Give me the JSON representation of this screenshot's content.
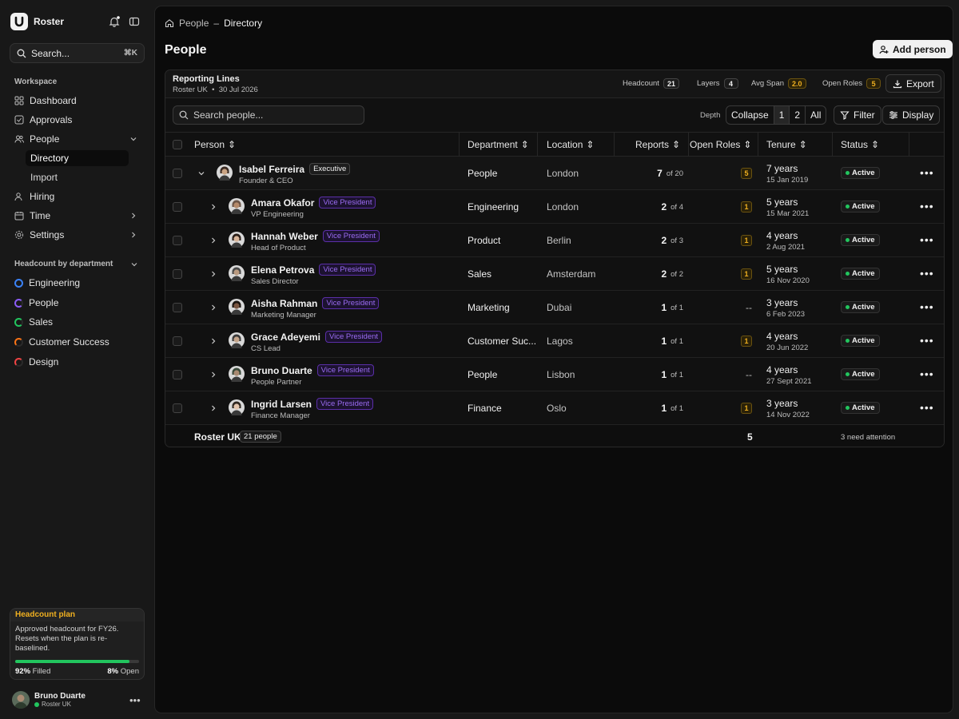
{
  "app": {
    "name": "Roster"
  },
  "search": {
    "placeholder": "Search...",
    "shortcut": "⌘K"
  },
  "sidebar": {
    "section_workspace": "Workspace",
    "items": [
      {
        "label": "Dashboard",
        "icon": "grid-icon"
      },
      {
        "label": "Approvals",
        "icon": "check-square-icon"
      },
      {
        "label": "People",
        "icon": "users-icon"
      },
      {
        "label": "Hiring",
        "icon": "user-plus-icon"
      },
      {
        "label": "Time",
        "icon": "calendar-icon"
      },
      {
        "label": "Settings",
        "icon": "gear-icon"
      }
    ],
    "people_sub": [
      {
        "label": "Directory"
      },
      {
        "label": "Import"
      }
    ],
    "section_headcount": "Headcount by department",
    "departments": [
      {
        "label": "Engineering",
        "color": "#3b82f6"
      },
      {
        "label": "People",
        "color": "#8b5cf6"
      },
      {
        "label": "Sales",
        "color": "#22c55e"
      },
      {
        "label": "Customer Success",
        "color": "#f97316"
      },
      {
        "label": "Design",
        "color": "#ef4444"
      }
    ]
  },
  "plan": {
    "title": "Headcount plan",
    "desc": "Approved headcount for FY26. Resets when the plan is re-baselined.",
    "filled_pct": "92%",
    "filled_label": "Filled",
    "open_pct": "8%",
    "open_label": "Open",
    "filled_value": 0.92
  },
  "user": {
    "name": "Bruno Duarte",
    "org": "Roster UK"
  },
  "breadcrumb": {
    "root": "People",
    "sep": "–",
    "current": "Directory"
  },
  "page": {
    "title": "People",
    "add_button": "Add person"
  },
  "panel": {
    "title": "Reporting Lines",
    "org": "Roster UK",
    "date": "30 Jul 2026",
    "stats": [
      {
        "label": "Headcount",
        "value": "21",
        "highlight": false
      },
      {
        "label": "Layers",
        "value": "4",
        "highlight": false
      },
      {
        "label": "Avg Span",
        "value": "2.0",
        "highlight": true
      },
      {
        "label": "Open Roles",
        "value": "5",
        "highlight": true
      }
    ],
    "export": "Export"
  },
  "toolbar": {
    "search_placeholder": "Search people...",
    "depth_label": "Depth",
    "depth_options": [
      "Collapse",
      "1",
      "2",
      "All"
    ],
    "filter": "Filter",
    "display": "Display"
  },
  "table": {
    "columns": [
      "Person",
      "Department",
      "Location",
      "Reports",
      "Open Roles",
      "Tenure",
      "Status"
    ],
    "rows": [
      {
        "name": "Isabel Ferreira",
        "role": "Founder & CEO",
        "tag": "Executive",
        "tagType": "exec",
        "dept": "People",
        "loc": "London",
        "rep": "7",
        "repOf": "of 20",
        "open": "5",
        "tenure": "7 years",
        "since": "15 Jan 2019",
        "status": "Active",
        "expanded": true,
        "skin": "#c9a383",
        "hair": "#3a2a22"
      },
      {
        "name": "Amara Okafor",
        "role": "VP Engineering",
        "tag": "Vice President",
        "tagType": "vp",
        "dept": "Engineering",
        "loc": "London",
        "rep": "2",
        "repOf": "of 4",
        "open": "1",
        "tenure": "5 years",
        "since": "15 Mar 2021",
        "status": "Active",
        "expanded": false,
        "skin": "#b58a6b",
        "hair": "#6b5548"
      },
      {
        "name": "Hannah Weber",
        "role": "Head of Product",
        "tag": "Vice President",
        "tagType": "vp",
        "dept": "Product",
        "loc": "Berlin",
        "rep": "2",
        "repOf": "of 3",
        "open": "1",
        "tenure": "4 years",
        "since": "2 Aug 2021",
        "status": "Active",
        "expanded": false,
        "skin": "#d8b59a",
        "hair": "#2a1e18"
      },
      {
        "name": "Elena Petrova",
        "role": "Sales Director",
        "tag": "Vice President",
        "tagType": "vp",
        "dept": "Sales",
        "loc": "Amsterdam",
        "rep": "2",
        "repOf": "of 2",
        "open": "1",
        "tenure": "5 years",
        "since": "16 Nov 2020",
        "status": "Active",
        "expanded": false,
        "skin": "#b99a80",
        "hair": "#4a4a4a"
      },
      {
        "name": "Aisha Rahman",
        "role": "Marketing Manager",
        "tag": "Vice President",
        "tagType": "vp",
        "dept": "Marketing",
        "loc": "Dubai",
        "rep": "1",
        "repOf": "of 1",
        "open": "--",
        "tenure": "3 years",
        "since": "6 Feb 2023",
        "status": "Active",
        "expanded": false,
        "skin": "#7a5642",
        "hair": "#1a1410"
      },
      {
        "name": "Grace Adeyemi",
        "role": "CS Lead",
        "tag": "Vice President",
        "tagType": "vp",
        "dept": "Customer Suc...",
        "loc": "Lagos",
        "rep": "1",
        "repOf": "of 1",
        "open": "1",
        "tenure": "4 years",
        "since": "20 Jun 2022",
        "status": "Active",
        "expanded": false,
        "skin": "#c4a48a",
        "hair": "#3a3a3a"
      },
      {
        "name": "Bruno Duarte",
        "role": "People Partner",
        "tag": "Vice President",
        "tagType": "vp",
        "dept": "People",
        "loc": "Lisbon",
        "rep": "1",
        "repOf": "of 1",
        "open": "--",
        "tenure": "4 years",
        "since": "27 Sept 2021",
        "status": "Active",
        "expanded": false,
        "skin": "#a98a72",
        "hair": "#3a4a3a"
      },
      {
        "name": "Ingrid Larsen",
        "role": "Finance Manager",
        "tag": "Vice President",
        "tagType": "vp",
        "dept": "Finance",
        "loc": "Oslo",
        "rep": "1",
        "repOf": "of 1",
        "open": "1",
        "tenure": "3 years",
        "since": "14 Nov 2022",
        "status": "Active",
        "expanded": false,
        "skin": "#e2c4ad",
        "hair": "#2e2620"
      }
    ],
    "footer": {
      "org": "Roster UK",
      "count": "21 people",
      "open_total": "5",
      "attention": "3 need attention"
    }
  }
}
